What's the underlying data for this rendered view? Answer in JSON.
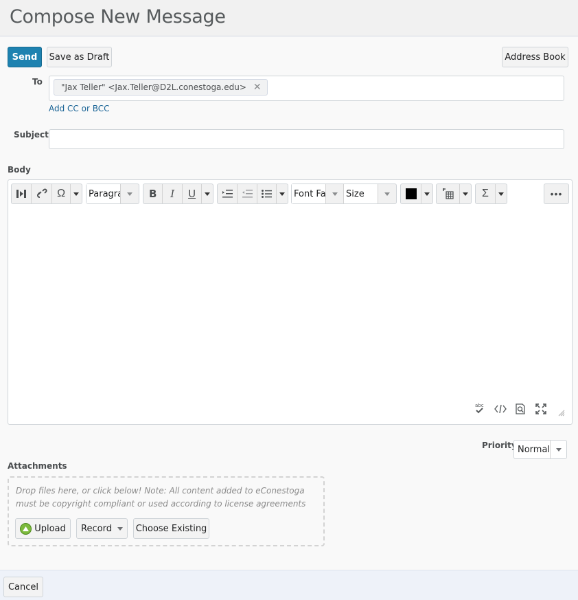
{
  "page": {
    "title": "Compose New Message"
  },
  "toolbar": {
    "send_label": "Send",
    "save_draft_label": "Save as Draft",
    "address_book_label": "Address Book"
  },
  "to": {
    "label": "To",
    "recipient": "\"Jax Teller\" <Jax.Teller@D2L.conestoga.edu>",
    "add_cc_bcc": "Add CC or BCC"
  },
  "subject": {
    "label": "Subject",
    "value": ""
  },
  "body": {
    "label": "Body",
    "toolbar": {
      "paragraph": "Paragraph",
      "font_family": "Font Family",
      "size": "Size",
      "text_color": "#000000"
    }
  },
  "priority": {
    "label": "Priority",
    "value": "Normal"
  },
  "attachments": {
    "label": "Attachments",
    "dropzone_text": "Drop files here, or click below! Note: All content added to eConestoga must be copyright compliant or used according to license agreements",
    "upload_label": "Upload",
    "record_label": "Record",
    "choose_existing_label": "Choose Existing"
  },
  "footer": {
    "cancel_label": "Cancel"
  }
}
